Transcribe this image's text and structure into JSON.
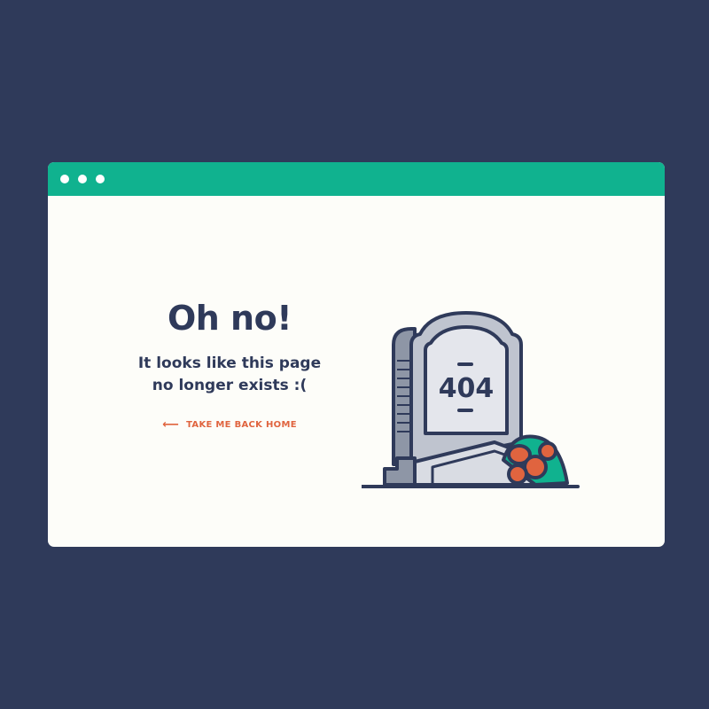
{
  "window": {
    "titlebar_color": "#10b28f",
    "controls": [
      "dot",
      "dot",
      "dot"
    ]
  },
  "message": {
    "heading": "Oh no!",
    "line1": "It looks like this page",
    "line2": "no longer exists :("
  },
  "link": {
    "icon": "arrow-left-icon",
    "label": "TAKE ME BACK HOME",
    "color": "#e0643f"
  },
  "illustration": {
    "icon": "tombstone-icon",
    "text": "404"
  },
  "colors": {
    "background": "#2f3a5a",
    "window": "#fdfdf9",
    "text": "#2f3a5a"
  }
}
